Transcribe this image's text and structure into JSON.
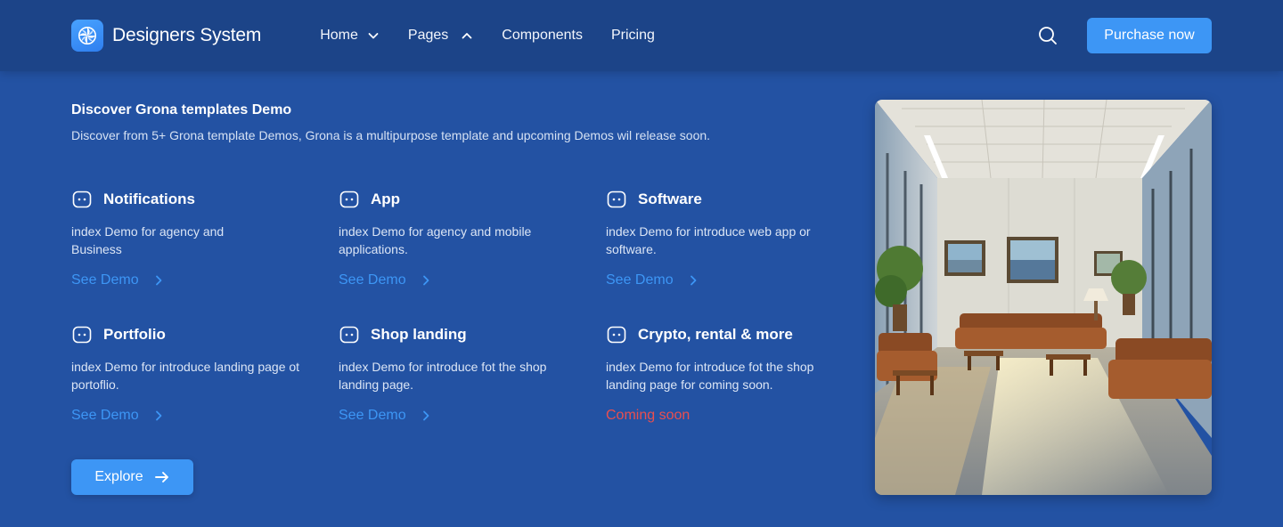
{
  "brand": {
    "name": "Designers System",
    "logo_icon": "aperture-icon",
    "logo_color": "#3d96f5"
  },
  "nav": {
    "items": [
      {
        "label": "Home",
        "icon": "chevron-down-icon"
      },
      {
        "label": "Pages",
        "icon": "chevron-up-icon"
      },
      {
        "label": "Components"
      },
      {
        "label": "Pricing"
      }
    ],
    "search_icon": "search-icon",
    "purchase_label": "Purchase now"
  },
  "section": {
    "title": "Discover Grona templates Demo",
    "subtitle": "Discover from 5+ Grona template Demos, Grona is a multipurpose template and upcoming Demos wil release soon."
  },
  "demos": [
    {
      "title": "Notifications",
      "description": "index Demo for agency and Business",
      "link": "See Demo"
    },
    {
      "title": "App",
      "description": "index Demo for agency and mobile applications.",
      "link": "See Demo"
    },
    {
      "title": "Software",
      "description": "index Demo for introduce web app or software.",
      "link": "See Demo"
    },
    {
      "title": "Portfolio",
      "description": "index Demo for introduce landing page ot portoflio.",
      "link": "See Demo"
    },
    {
      "title": "Shop landing",
      "description": "index Demo for introduce fot the shop landing page.",
      "link": "See Demo"
    },
    {
      "title": "Crypto, rental & more",
      "description": "index Demo for introduce fot the shop landing page for coming soon.",
      "status": "Coming soon"
    }
  ],
  "explore_label": "Explore",
  "colors": {
    "background": "#2352a3",
    "navbar": "#1c4488",
    "accent": "#3d96f5",
    "coming_soon": "#ea4f4f"
  }
}
